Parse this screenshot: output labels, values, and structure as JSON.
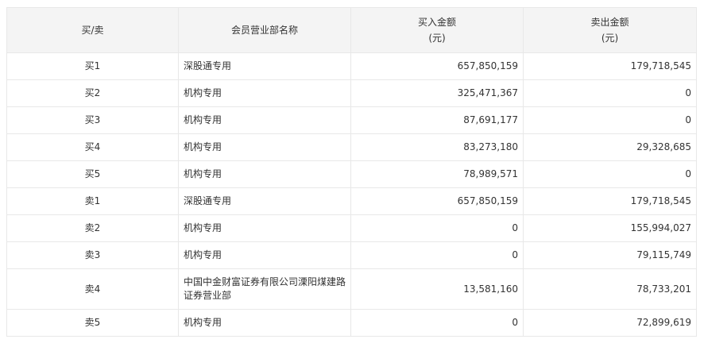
{
  "columns": {
    "type": "买/卖",
    "name": "会员营业部名称",
    "buy_line1": "买入金额",
    "buy_line2": "(元)",
    "sell_line1": "卖出金额",
    "sell_line2": "(元)"
  },
  "rows": [
    {
      "type": "买1",
      "name": "深股通专用",
      "buy": "657,850,159",
      "sell": "179,718,545"
    },
    {
      "type": "买2",
      "name": "机构专用",
      "buy": "325,471,367",
      "sell": "0"
    },
    {
      "type": "买3",
      "name": "机构专用",
      "buy": "87,691,177",
      "sell": "0"
    },
    {
      "type": "买4",
      "name": "机构专用",
      "buy": "83,273,180",
      "sell": "29,328,685"
    },
    {
      "type": "买5",
      "name": "机构专用",
      "buy": "78,989,571",
      "sell": "0"
    },
    {
      "type": "卖1",
      "name": "深股通专用",
      "buy": "657,850,159",
      "sell": "179,718,545"
    },
    {
      "type": "卖2",
      "name": "机构专用",
      "buy": "0",
      "sell": "155,994,027"
    },
    {
      "type": "卖3",
      "name": "机构专用",
      "buy": "0",
      "sell": "79,115,749"
    },
    {
      "type": "卖4",
      "name": "中国中金财富证券有限公司溧阳煤建路证券营业部",
      "buy": "13,581,160",
      "sell": "78,733,201"
    },
    {
      "type": "卖5",
      "name": "机构专用",
      "buy": "0",
      "sell": "72,899,619"
    }
  ],
  "colors": {
    "header_bg": "#f4f4f4",
    "border": "#e8e8e8",
    "text": "#333333"
  }
}
